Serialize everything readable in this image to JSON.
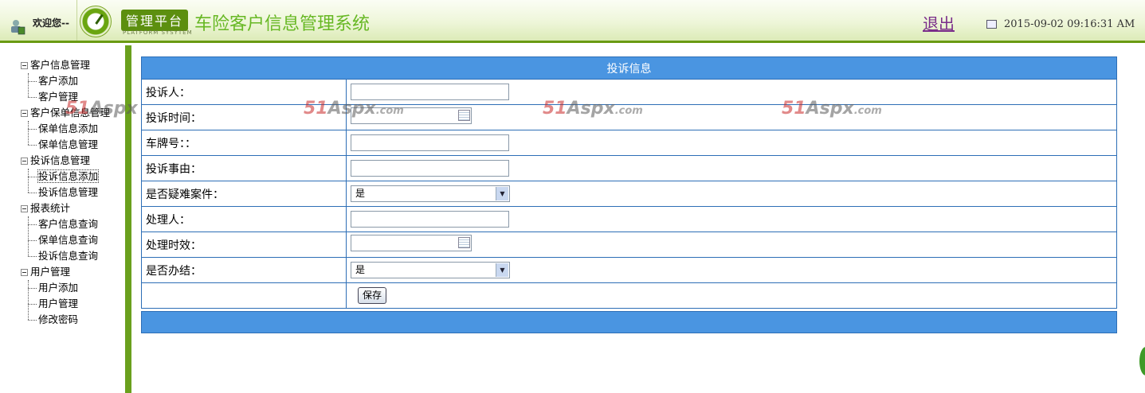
{
  "header": {
    "welcome": "欢迎您--",
    "badge": "管理平台",
    "badge_sub": "PLATFORM SYSYTEM",
    "system_title": "车险客户信息管理系统",
    "logout": "退出",
    "datetime": "2015-09-02 09:16:31 AM"
  },
  "sidebar": {
    "groups": [
      {
        "label": "客户信息管理",
        "items": [
          "客户添加",
          "客户管理"
        ]
      },
      {
        "label": "客户保单信息管理",
        "items": [
          "保单信息添加",
          "保单信息管理"
        ]
      },
      {
        "label": "投诉信息管理",
        "items": [
          "投诉信息添加",
          "投诉信息管理"
        ]
      },
      {
        "label": "报表统计",
        "items": [
          "客户信息查询",
          "保单信息查询",
          "投诉信息查询"
        ]
      },
      {
        "label": "用户管理",
        "items": [
          "用户添加",
          "用户管理",
          "修改密码"
        ]
      }
    ]
  },
  "watermark": {
    "brand": "51",
    "mid": "Aspx",
    "tld": ".com"
  },
  "form": {
    "title": "投诉信息",
    "fields": [
      {
        "label": "投诉人：",
        "value": ""
      },
      {
        "label": "投诉时间：",
        "value": ""
      },
      {
        "label": "车牌号：：",
        "value": ""
      },
      {
        "label": "投诉事由：",
        "value": ""
      },
      {
        "label": "是否疑难案件：",
        "value": "是"
      },
      {
        "label": "处理人：",
        "value": ""
      },
      {
        "label": "处理时效：",
        "value": ""
      },
      {
        "label": "是否办结：",
        "value": "是"
      }
    ],
    "save_label": "保存"
  }
}
